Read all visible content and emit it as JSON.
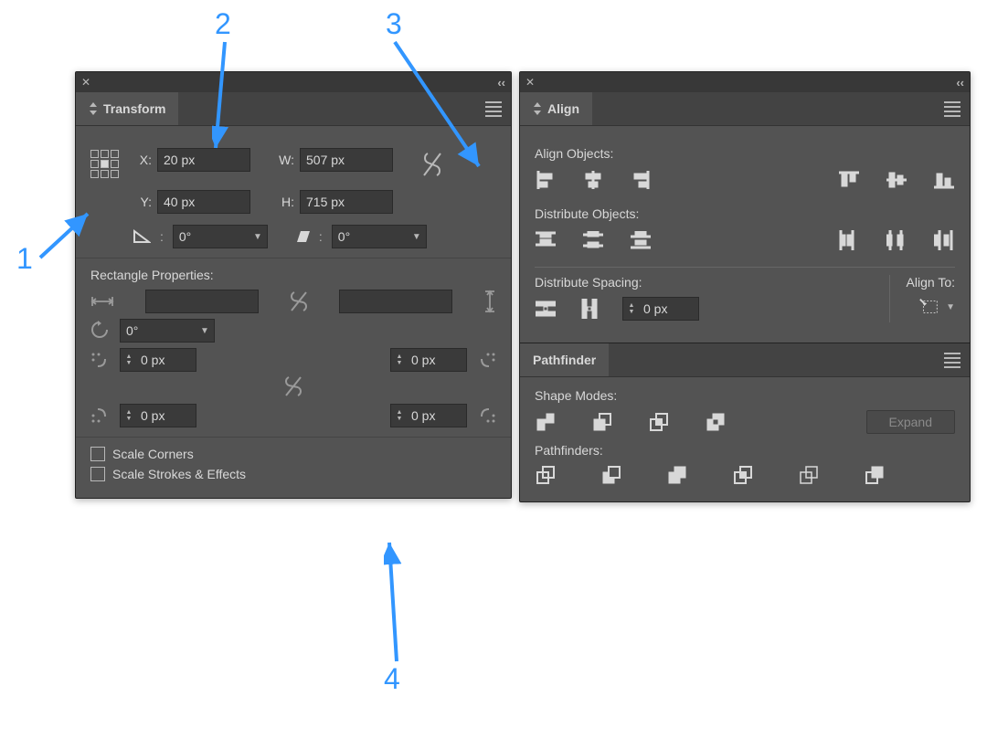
{
  "annotations": {
    "n1": "1",
    "n2": "2",
    "n3": "3",
    "n4": "4"
  },
  "transform": {
    "tab_label": "Transform",
    "x_label": "X:",
    "x_value": "20 px",
    "y_label": "Y:",
    "y_value": "40 px",
    "w_label": "W:",
    "w_value": "507 px",
    "h_label": "H:",
    "h_value": "715 px",
    "rotate_label": "",
    "rotate_value": "0°",
    "shear_label": "",
    "shear_value": "0°",
    "rect_section": "Rectangle Properties:",
    "rect_rotate": "0°",
    "corner_tl": "0 px",
    "corner_tr": "0 px",
    "corner_bl": "0 px",
    "corner_br": "0 px",
    "scale_corners": "Scale Corners",
    "scale_strokes": "Scale Strokes & Effects"
  },
  "align": {
    "tab_label": "Align",
    "align_objects": "Align Objects:",
    "distribute_objects": "Distribute Objects:",
    "distribute_spacing": "Distribute Spacing:",
    "align_to": "Align To:",
    "spacing_value": "0 px"
  },
  "pathfinder": {
    "tab_label": "Pathfinder",
    "shape_modes": "Shape Modes:",
    "pathfinders": "Pathfinders:",
    "expand": "Expand"
  }
}
